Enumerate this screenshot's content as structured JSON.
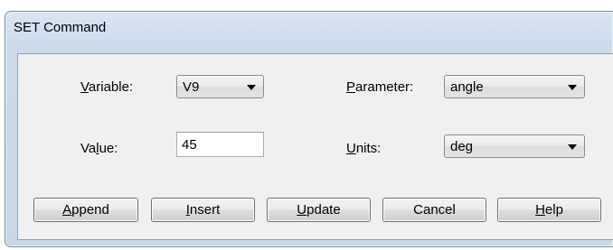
{
  "window": {
    "title": "SET Command"
  },
  "fields": {
    "variable": {
      "label_mnemonic": "V",
      "label_rest": "ariable:",
      "value": "V9"
    },
    "parameter": {
      "label_mnemonic": "P",
      "label_rest": "arameter:",
      "value": "angle"
    },
    "value": {
      "label_pre": "Va",
      "label_mnemonic": "l",
      "label_rest": "ue:",
      "value": "45"
    },
    "units": {
      "label_mnemonic": "U",
      "label_rest": "nits:",
      "value": "deg"
    }
  },
  "buttons": {
    "append": {
      "mnemonic": "A",
      "rest": "ppend"
    },
    "insert": {
      "mnemonic": "I",
      "rest": "nsert"
    },
    "update": {
      "mnemonic": "U",
      "rest": "pdate"
    },
    "cancel": {
      "label": "Cancel"
    },
    "help": {
      "mnemonic": "H",
      "rest": "elp"
    }
  }
}
